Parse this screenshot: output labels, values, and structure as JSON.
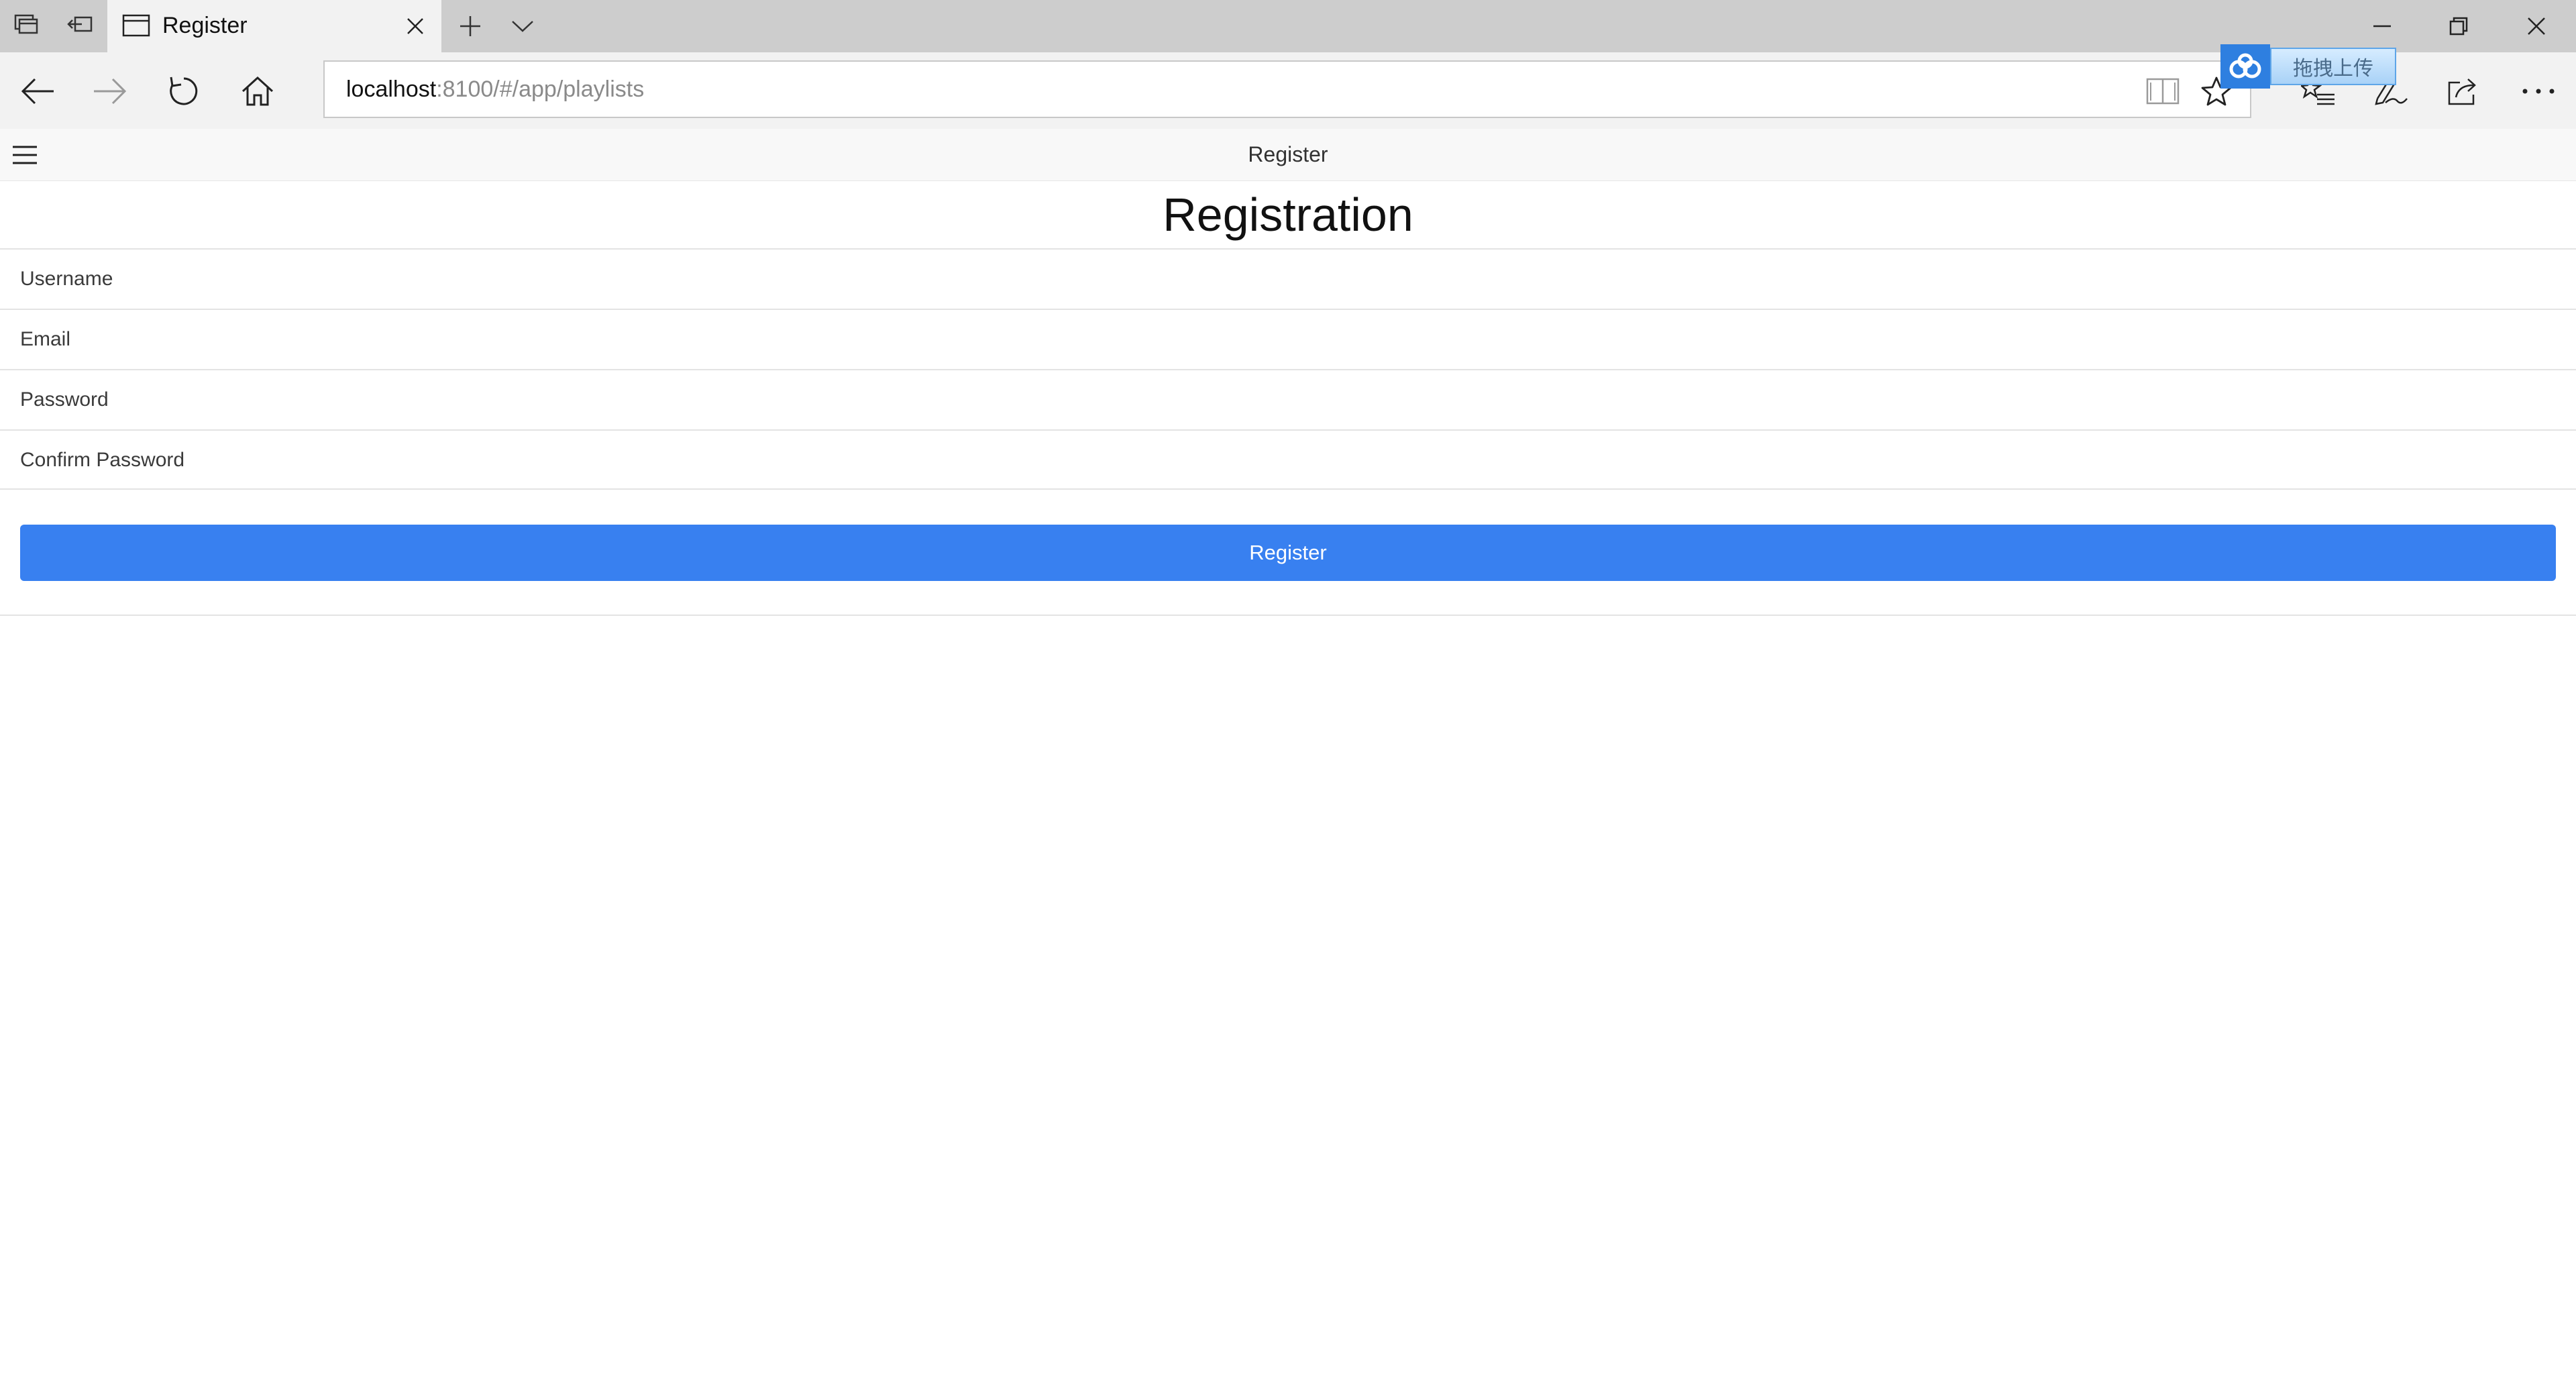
{
  "browser": {
    "tab": {
      "title": "Register"
    },
    "address": {
      "host": "localhost",
      "rest": ":8100/#/app/playlists"
    },
    "icons": {
      "tab_preview": "tab-preview-icon",
      "set_aside": "set-tabs-aside-icon",
      "page": "page-icon",
      "close": "close-icon",
      "new_tab": "plus-icon",
      "tab_list": "chevron-down-icon",
      "back": "arrow-left-icon",
      "forward": "arrow-right-icon",
      "refresh": "refresh-icon",
      "home": "home-icon",
      "reading_view": "book-icon",
      "favorite": "star-icon",
      "favorites_hub": "favorites-list-icon",
      "notes": "pen-icon",
      "share": "share-icon",
      "more": "more-icon",
      "minimize": "minimize-icon",
      "restore": "restore-icon",
      "window_close": "close-icon"
    }
  },
  "upload_widget": {
    "label": "拖拽上传"
  },
  "header": {
    "title": "Register"
  },
  "form": {
    "heading": "Registration",
    "fields": [
      {
        "placeholder": "Username",
        "value": ""
      },
      {
        "placeholder": "Email",
        "value": ""
      },
      {
        "placeholder": "Password",
        "value": ""
      },
      {
        "placeholder": "Confirm Password",
        "value": ""
      }
    ],
    "submit_label": "Register"
  },
  "colors": {
    "accent": "#3880f0",
    "tab_bar": "#cdcdcd",
    "toolbar": "#f2f2f2",
    "header_bg": "#f8f8f8"
  }
}
